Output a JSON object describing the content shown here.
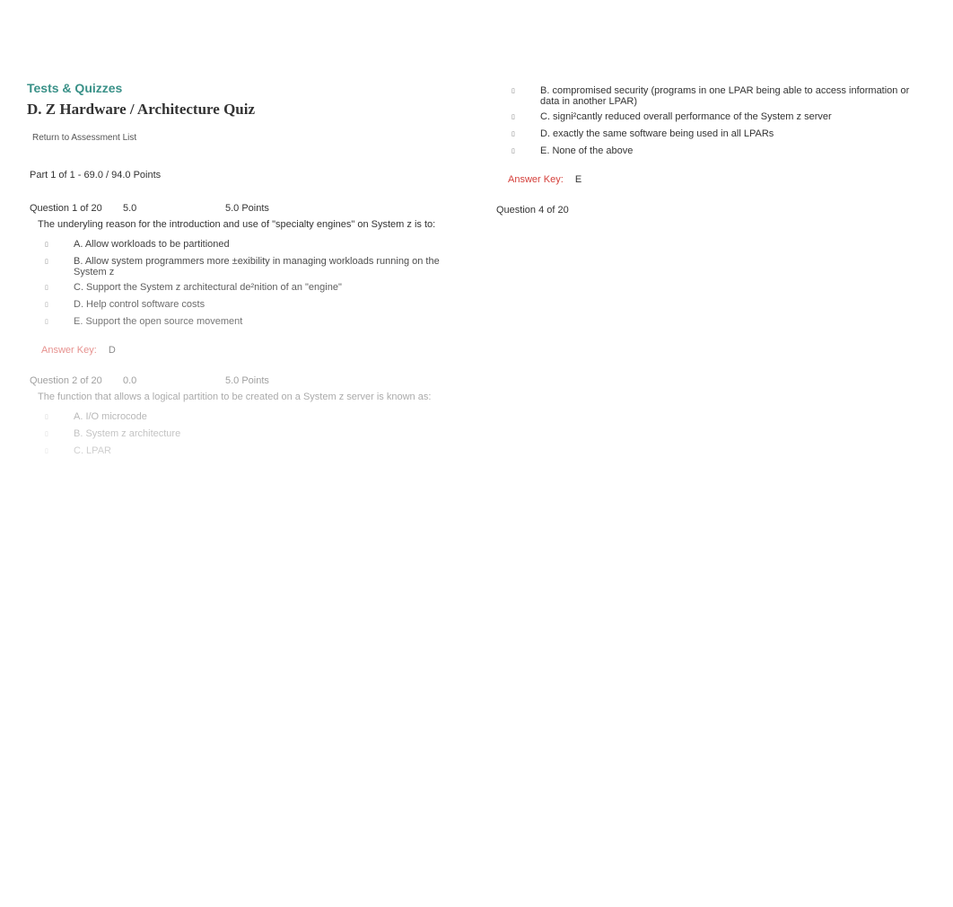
{
  "heading": "Tests & Quizzes",
  "title": "D. Z Hardware / Architecture Quiz",
  "return_link": "Return to Assessment List",
  "part_summary": "Part 1 of 1     - 69.0 / 94.0 Points",
  "q1": {
    "id": "Question 1 of 20",
    "score": "5.0",
    "points": "5.0 Points",
    "prompt": "The underyling reason for the introduction and use of \"specialty engines\" on System z is to:",
    "opts": [
      "A. Allow workloads to be partitioned",
      "B. Allow system programmers more ±exibility in managing workloads running on the System z",
      "C. Support the System z architectural de²nition of an \"engine\"",
      "D. Help control software costs",
      "E. Support the open source movement"
    ],
    "answer_label": "Answer Key:",
    "answer": "D"
  },
  "q2": {
    "id": "Question 2 of 20",
    "score": "0.0",
    "points": "5.0 Points",
    "prompt": "The function that allows a logical partition to be created on a System z server is known as:",
    "opts": [
      "A. I/O microcode",
      "B. System z architecture",
      "C. LPAR"
    ]
  },
  "q3_tail": {
    "opts": [
      "B. compromised security (programs in one LPAR being able to access information or data in another LPAR)",
      "C. signi²cantly reduced overall performance of the System z server",
      "D. exactly the same software being used in all LPARs",
      "E. None of the above"
    ],
    "answer_label": "Answer Key:",
    "answer": "E"
  },
  "q4": {
    "id": "Question 4 of 20"
  }
}
